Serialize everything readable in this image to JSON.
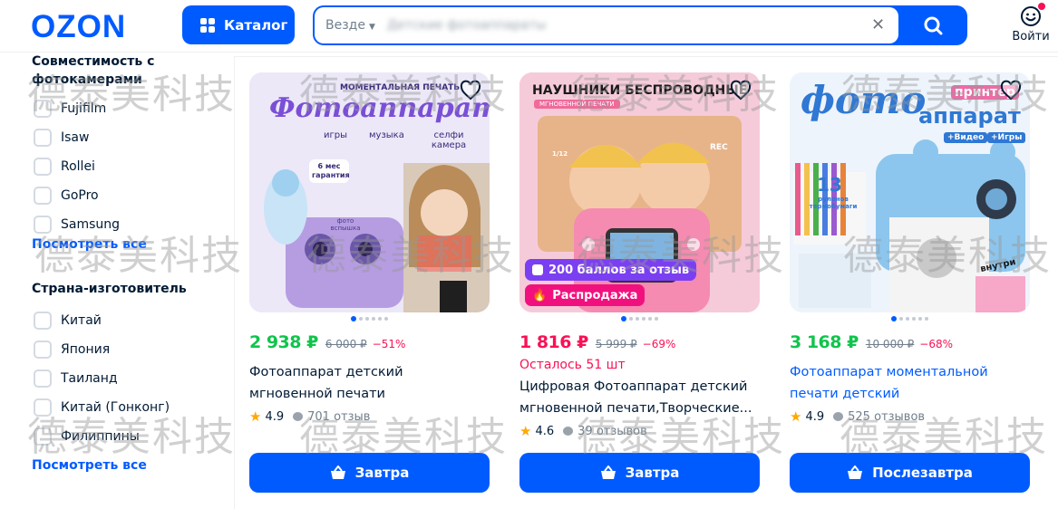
{
  "header": {
    "logo": "OZON",
    "catalog_label": "Каталог",
    "search": {
      "scope": "Везде",
      "query": "Детские фотоаппараты"
    },
    "login_label": "Войти"
  },
  "sidebar": {
    "camera_compat": {
      "title": "Совместимость с фотокамерами",
      "options": [
        "Fujifilm",
        "Isaw",
        "Rollei",
        "GoPro",
        "Samsung"
      ],
      "show_all": "Посмотреть все"
    },
    "country": {
      "title": "Страна-изготовитель",
      "options": [
        "Китай",
        "Япония",
        "Таиланд",
        "Китай (Гонконг)",
        "Филиппины"
      ],
      "show_all": "Посмотреть все"
    }
  },
  "products": [
    {
      "image_text": [
        "МОМЕНТАЛЬНАЯ ПЕЧАТЬ",
        "Фотоаппарат",
        "игры",
        "музыка",
        "селфи камера",
        "6 мес гарантия",
        "фото вспышка"
      ],
      "price": "2 938 ₽",
      "old_price": "6 000 ₽",
      "discount": "−51%",
      "title": "Фотоаппарат детский мгновенной печати",
      "rating": "4.9",
      "reviews": "701 отзыв",
      "button": "Завтра"
    },
    {
      "image_text": [
        "НАУШНИКИ БЕСПРОВОДНЫЕ",
        "МГНОВЕННОЙ ПЕЧАТИ",
        "REC",
        "1/12"
      ],
      "badges": [
        "200 баллов за отзыв",
        "Распродажа"
      ],
      "price": "1 816 ₽",
      "old_price": "5 999 ₽",
      "discount": "−69%",
      "stock": "Осталось 51 шт",
      "title": "Цифровая Фотоаппарат детский мгновенной печати,Творческие...",
      "rating": "4.6",
      "reviews": "39 отзывов",
      "button": "Завтра"
    },
    {
      "image_text": [
        "фото",
        "принтер",
        "аппарат",
        "+Видео",
        "+Игры",
        "13",
        "рулонов термобумаги",
        "внутри"
      ],
      "price": "3 168 ₽",
      "old_price": "10 000 ₽",
      "discount": "−68%",
      "title": "Фотоаппарат моментальной печати детский",
      "rating": "4.9",
      "reviews": "525 отзывов",
      "button": "Послезавтра"
    }
  ],
  "watermark": "德泰美科技",
  "colors": {
    "brand": "#005bff",
    "price_green": "#10c44c",
    "price_red": "#f91155",
    "points_badge": "#7b3ff2",
    "sale_badge": "#f1117e"
  },
  "icons": [
    "grid-icon",
    "chevron-down-icon",
    "close-icon",
    "search-icon",
    "smiley-icon",
    "heart-icon",
    "star-icon",
    "chat-bubble-icon",
    "basket-icon"
  ]
}
